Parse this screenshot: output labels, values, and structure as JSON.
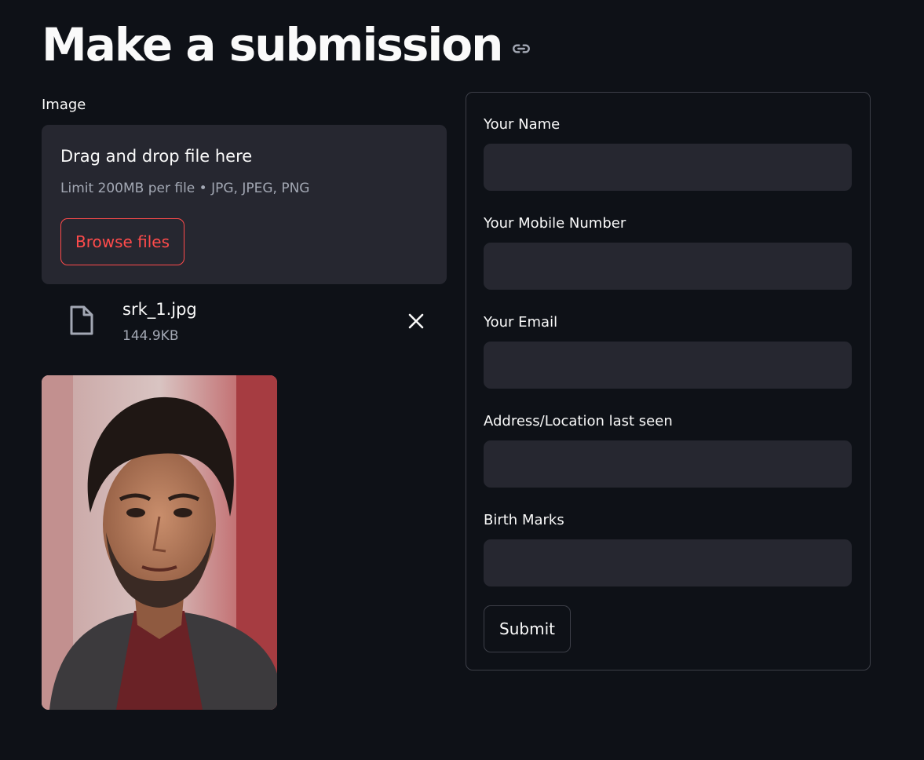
{
  "page": {
    "title": "Make a submission",
    "anchor_icon": "link-icon"
  },
  "uploader": {
    "label": "Image",
    "drop_text": "Drag and drop file here",
    "limit_text": "Limit 200MB per file • JPG, JPEG, PNG",
    "browse_label": "Browse files",
    "accent_color": "#ff4b4b",
    "file": {
      "name": "srk_1.jpg",
      "size": "144.9KB",
      "icon": "file-icon",
      "remove_icon": "close-icon"
    }
  },
  "form": {
    "fields": [
      {
        "label": "Your Name",
        "value": ""
      },
      {
        "label": "Your Mobile Number",
        "value": ""
      },
      {
        "label": "Your Email",
        "value": ""
      },
      {
        "label": "Address/Location last seen",
        "value": ""
      },
      {
        "label": "Birth Marks",
        "value": ""
      }
    ],
    "submit_label": "Submit"
  },
  "colors": {
    "background": "#0e1117",
    "panel": "#262730",
    "border": "#3d3f48",
    "text": "#fafafa",
    "muted": "#a3a8b4"
  }
}
